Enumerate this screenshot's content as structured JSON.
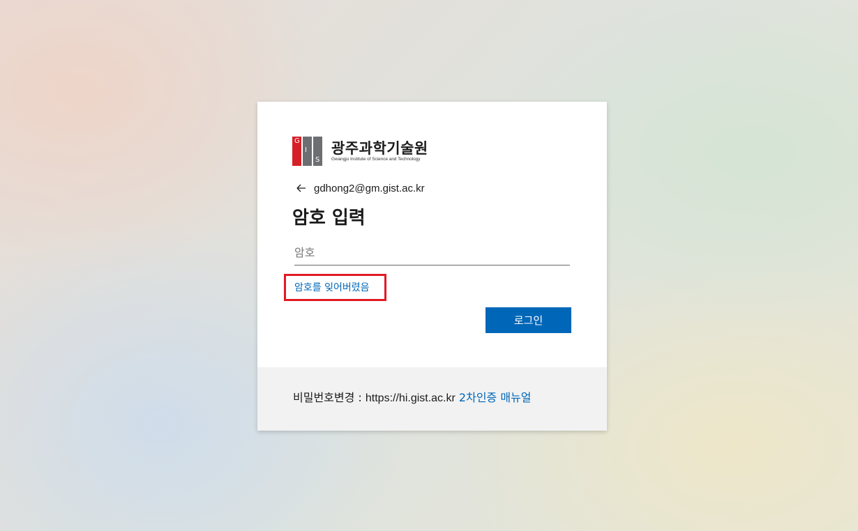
{
  "brand": {
    "mark_letters": [
      "G",
      "I",
      "S",
      "T"
    ],
    "name": "광주과학기술원",
    "subtitle": "Gwangju Institute of Science and Technology",
    "colors": {
      "red": "#d62027",
      "gray": "#6d6e71"
    }
  },
  "identity": {
    "back_icon": "arrow-left-icon",
    "email": "gdhong2@gm.gist.ac.kr"
  },
  "form": {
    "title": "암호 입력",
    "password_placeholder": "암호",
    "password_value": "",
    "forgot_link": "암호를 잊어버렸음",
    "submit_label": "로그인"
  },
  "footer": {
    "prefix": "비밀번호변경 : ",
    "url": "https://hi.gist.ac.kr",
    "manual_link": "2차인증 매뉴얼"
  },
  "colors": {
    "accent": "#0067b8",
    "highlight": "#e21a23"
  }
}
